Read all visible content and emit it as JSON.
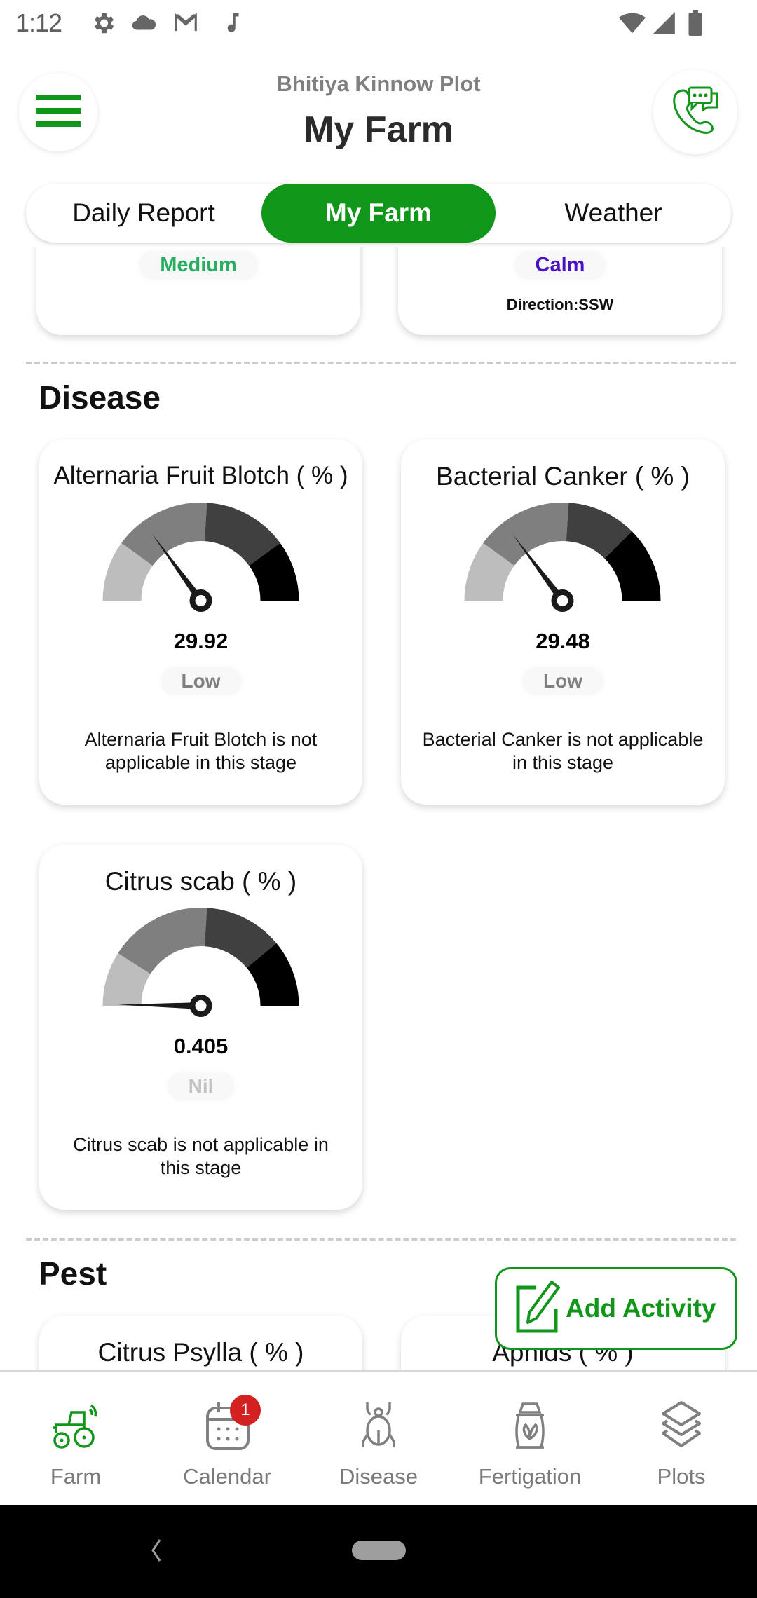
{
  "status_bar": {
    "time": "1:12",
    "left_icons": [
      "gear-icon",
      "cloud-icon",
      "gmail-icon",
      "music-note-icon"
    ],
    "right_icons": [
      "wifi-icon",
      "signal-icon",
      "battery-icon"
    ]
  },
  "header": {
    "subtitle": "Bhitiya Kinnow Plot",
    "title": "My Farm",
    "menu_icon": "hamburger-menu-icon",
    "support_icon": "phone-chat-icon"
  },
  "tabs": [
    {
      "label": "Daily Report",
      "active": false
    },
    {
      "label": "My Farm",
      "active": true
    },
    {
      "label": "Weather",
      "active": false
    }
  ],
  "top_cards": [
    {
      "level": "Medium",
      "level_color": "#27ae60"
    },
    {
      "level": "Calm",
      "level_color": "#4b12c2",
      "detail": "Direction:SSW"
    }
  ],
  "disease": {
    "heading": "Disease",
    "cards": [
      {
        "title": "Alternaria Fruit Blotch ( % )",
        "value": "29.92",
        "level": "Low",
        "level_color": "#808080",
        "note": "Alternaria Fruit Blotch is not applicable in this stage"
      },
      {
        "title": "Bacterial Canker ( % )",
        "value": "29.48",
        "level": "Low",
        "level_color": "#808080",
        "note": "Bacterial Canker is not applicable in this stage"
      },
      {
        "title": "Citrus scab ( % )",
        "value": "0.405",
        "level": "Nil",
        "level_color": "#c4c4c4",
        "note": "Citrus scab is not applicable in this stage"
      }
    ]
  },
  "pest": {
    "heading": "Pest",
    "cards": [
      {
        "title": "Citrus Psylla ( % )"
      },
      {
        "title": "Aphids ( % )"
      }
    ]
  },
  "add_activity": {
    "label": "Add Activity",
    "icon": "edit-note-icon"
  },
  "bottom_nav": [
    {
      "label": "Farm",
      "icon": "tractor-icon",
      "active": true
    },
    {
      "label": "Calendar",
      "icon": "calendar-icon",
      "badge": "1"
    },
    {
      "label": "Disease",
      "icon": "bug-icon"
    },
    {
      "label": "Fertigation",
      "icon": "fertilizer-bag-icon"
    },
    {
      "label": "Plots",
      "icon": "layers-icon"
    }
  ],
  "colors": {
    "brand_green": "#109618",
    "badge_red": "#d32020"
  },
  "chart_data": [
    {
      "type": "gauge",
      "title": "Alternaria Fruit Blotch ( % )",
      "value": 29.92,
      "range": [
        0,
        100
      ],
      "bands": [
        {
          "to": 20,
          "color": "#bdbdbd"
        },
        {
          "to": 52,
          "color": "#7f7f7f"
        },
        {
          "to": 80,
          "color": "#404040"
        },
        {
          "to": 100,
          "color": "#000000"
        }
      ]
    },
    {
      "type": "gauge",
      "title": "Bacterial Canker ( % )",
      "value": 29.48,
      "range": [
        0,
        100
      ],
      "bands": [
        {
          "to": 20,
          "color": "#bdbdbd"
        },
        {
          "to": 52,
          "color": "#7f7f7f"
        },
        {
          "to": 75,
          "color": "#404040"
        },
        {
          "to": 100,
          "color": "#000000"
        }
      ]
    },
    {
      "type": "gauge",
      "title": "Citrus scab ( % )",
      "value": 0.405,
      "range": [
        0,
        100
      ],
      "bands": [
        {
          "to": 18,
          "color": "#bdbdbd"
        },
        {
          "to": 52,
          "color": "#7f7f7f"
        },
        {
          "to": 78,
          "color": "#404040"
        },
        {
          "to": 100,
          "color": "#000000"
        }
      ]
    }
  ]
}
